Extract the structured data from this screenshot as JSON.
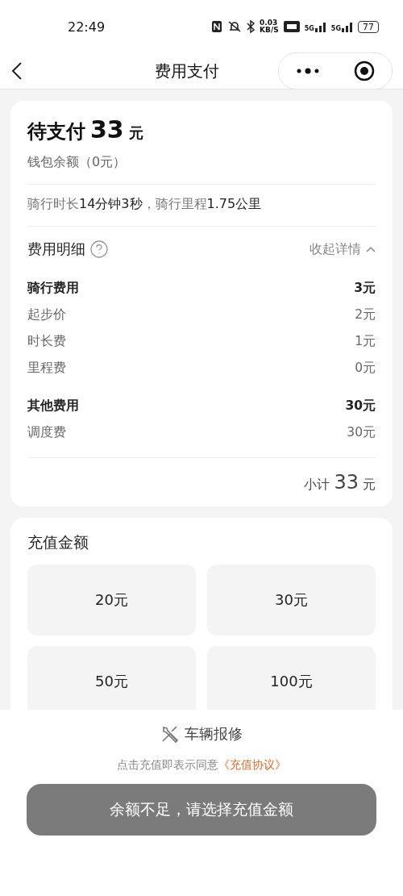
{
  "status_bar": {
    "time": "22:49",
    "speed": "0.03",
    "speed_unit": "KB/S",
    "network_1": "5G",
    "network_2": "5G",
    "battery": "77"
  },
  "nav": {
    "title": "费用支付"
  },
  "summary": {
    "label": "待支付",
    "amount": "33",
    "unit": "元",
    "wallet": "钱包余额（0元）",
    "ride_info": "骑行时长**14分钟3秒**，骑行里程**1.75公里**"
  },
  "fee_detail": {
    "title": "费用明细",
    "toggle": "收起详情",
    "expanded": true,
    "groups": [
      {
        "name": "骑行费用",
        "amount": "3元",
        "items": [
          {
            "name": "起步价",
            "amount": "2元"
          },
          {
            "name": "时长费",
            "amount": "1元"
          },
          {
            "name": "里程费",
            "amount": "0元"
          }
        ]
      },
      {
        "name": "其他费用",
        "amount": "30元",
        "items": [
          {
            "name": "调度费",
            "amount": "30元"
          }
        ]
      }
    ],
    "subtotal_label": "小计",
    "subtotal": "33",
    "subtotal_unit": "元"
  },
  "recharge": {
    "title": "充值金额",
    "options": [
      {
        "label": "20元",
        "selected": false
      },
      {
        "label": "30元",
        "selected": false
      },
      {
        "label": "50元",
        "selected": false
      },
      {
        "label": "100元",
        "selected": false
      }
    ]
  },
  "footer": {
    "repair": "车辆报修",
    "agreement_text": "点击充值即表示同意",
    "agreement_link": "《充值协议》",
    "button": "余额不足，请选择充值金额"
  }
}
